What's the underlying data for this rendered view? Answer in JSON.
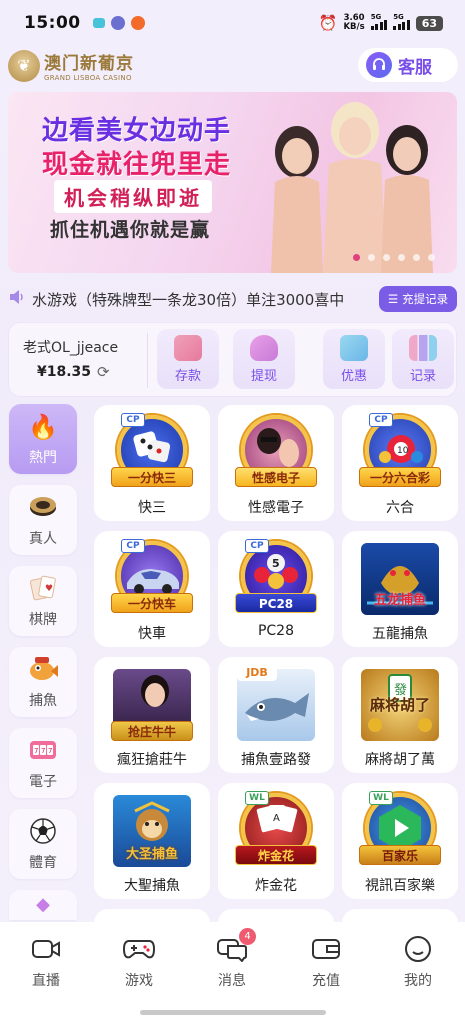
{
  "status": {
    "time": "15:00",
    "speed_value": "3.60",
    "speed_unit": "KB/s",
    "net1": "5G",
    "net2": "5G",
    "battery": "63"
  },
  "header": {
    "logo_cn": "澳门新葡京",
    "logo_en": "GRAND LISBOA CASINO",
    "service_label": "客服"
  },
  "banner": {
    "line1": "边看美女边动手",
    "line2": "现金就往兜里走",
    "line3": "机会稍纵即逝",
    "line4": "抓住机遇你就是赢"
  },
  "marquee": {
    "text": "水游戏（特殊牌型一条龙30倍）单注3000喜中",
    "button": "充提记录"
  },
  "wallet": {
    "username": "老式OL_jjeace",
    "balance": "¥18.35",
    "actions": [
      "存款",
      "提现",
      "优惠",
      "记录"
    ]
  },
  "sidebar": {
    "items": [
      "熱門",
      "真人",
      "棋牌",
      "捕魚",
      "電子",
      "體育"
    ]
  },
  "games": [
    {
      "name": "快三",
      "ribbon": "一分快三"
    },
    {
      "name": "性感電子",
      "ribbon": "性感电子"
    },
    {
      "name": "六合",
      "ribbon": "一分六合彩"
    },
    {
      "name": "快車",
      "ribbon": "一分快车"
    },
    {
      "name": "PC28",
      "ribbon": "PC28"
    },
    {
      "name": "五龍捕魚",
      "ribbon": "五龙捕鱼"
    },
    {
      "name": "瘋狂搶莊牛",
      "ribbon": "抢庄牛牛"
    },
    {
      "name": "捕魚壹路發",
      "ribbon": "JDB"
    },
    {
      "name": "麻將胡了萬",
      "ribbon": "麻将胡了"
    },
    {
      "name": "大聖捕魚",
      "ribbon": "大圣捕鱼"
    },
    {
      "name": "炸金花",
      "ribbon": "炸金花"
    },
    {
      "name": "視訊百家樂",
      "ribbon": "百家乐"
    }
  ],
  "nav": {
    "items": [
      "直播",
      "游戏",
      "消息",
      "充值",
      "我的"
    ],
    "message_badge": "4"
  },
  "colors": {
    "accent": "#7b5ce7",
    "active_tab": "#b79bf2",
    "gold": "#9c7a3c"
  }
}
